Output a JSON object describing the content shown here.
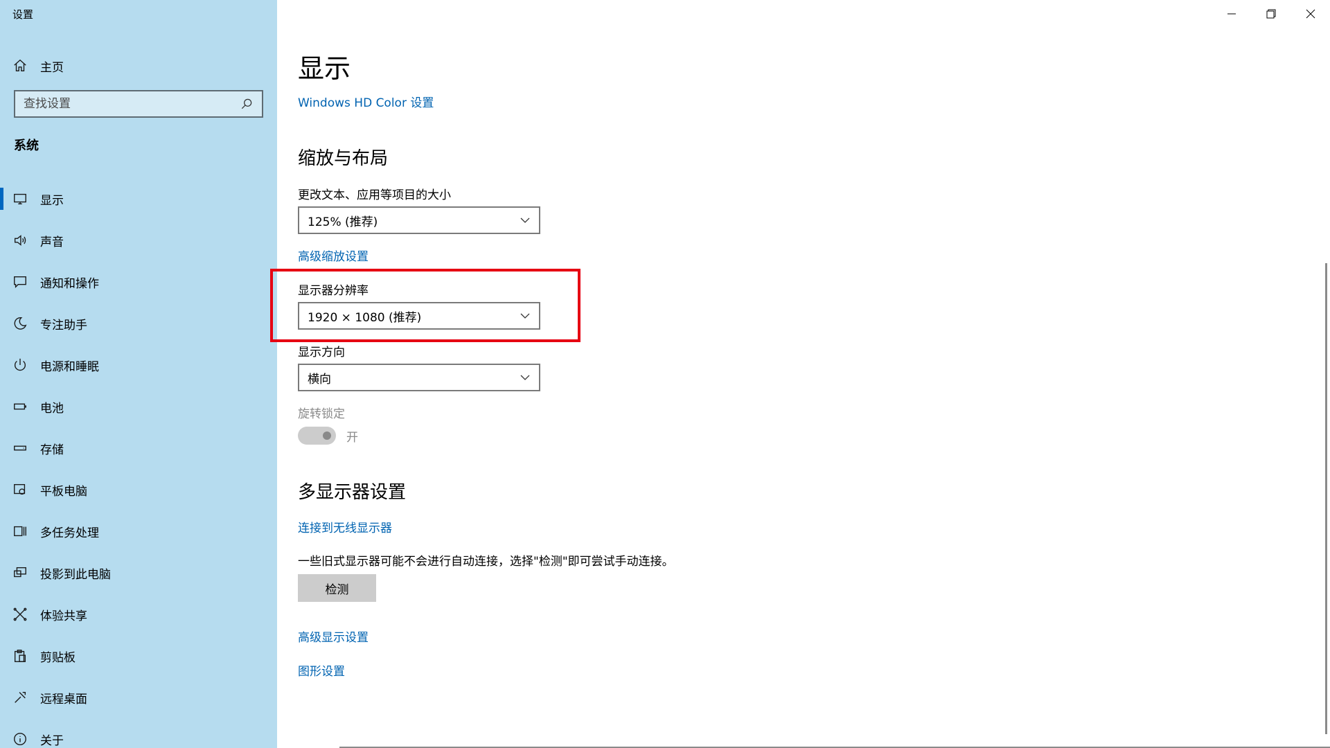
{
  "window": {
    "title": "设置"
  },
  "sidebar": {
    "home_label": "主页",
    "search_placeholder": "查找设置",
    "section": "系统",
    "items": [
      {
        "label": "显示",
        "icon": "monitor-icon",
        "active": true
      },
      {
        "label": "声音",
        "icon": "speaker-icon"
      },
      {
        "label": "通知和操作",
        "icon": "message-icon"
      },
      {
        "label": "专注助手",
        "icon": "moon-icon"
      },
      {
        "label": "电源和睡眠",
        "icon": "power-icon"
      },
      {
        "label": "电池",
        "icon": "battery-icon"
      },
      {
        "label": "存储",
        "icon": "storage-icon"
      },
      {
        "label": "平板电脑",
        "icon": "tablet-icon"
      },
      {
        "label": "多任务处理",
        "icon": "multitask-icon"
      },
      {
        "label": "投影到此电脑",
        "icon": "project-icon"
      },
      {
        "label": "体验共享",
        "icon": "share-icon"
      },
      {
        "label": "剪贴板",
        "icon": "clipboard-icon"
      },
      {
        "label": "远程桌面",
        "icon": "remote-icon"
      },
      {
        "label": "关于",
        "icon": "info-icon"
      }
    ]
  },
  "main": {
    "title": "显示",
    "hd_color_link": "Windows HD Color 设置",
    "scale_section": "缩放与布局",
    "scale_label": "更改文本、应用等项目的大小",
    "scale_value": "125% (推荐)",
    "advanced_scaling_link": "高级缩放设置",
    "resolution_label": "显示器分辨率",
    "resolution_value": "1920 × 1080 (推荐)",
    "orientation_label": "显示方向",
    "orientation_value": "横向",
    "rotation_lock_label": "旋转锁定",
    "rotation_lock_state": "开",
    "multi_display_section": "多显示器设置",
    "wireless_link": "连接到无线显示器",
    "detect_note": "一些旧式显示器可能不会进行自动连接，选择\"检测\"即可尝试手动连接。",
    "detect_button": "检测",
    "advanced_display_link": "高级显示设置",
    "graphics_link": "图形设置"
  },
  "colors": {
    "sidebar_bg": "#b6dcef",
    "link": "#0063b1",
    "highlight": "#e60012",
    "accent": "#0067c0"
  }
}
